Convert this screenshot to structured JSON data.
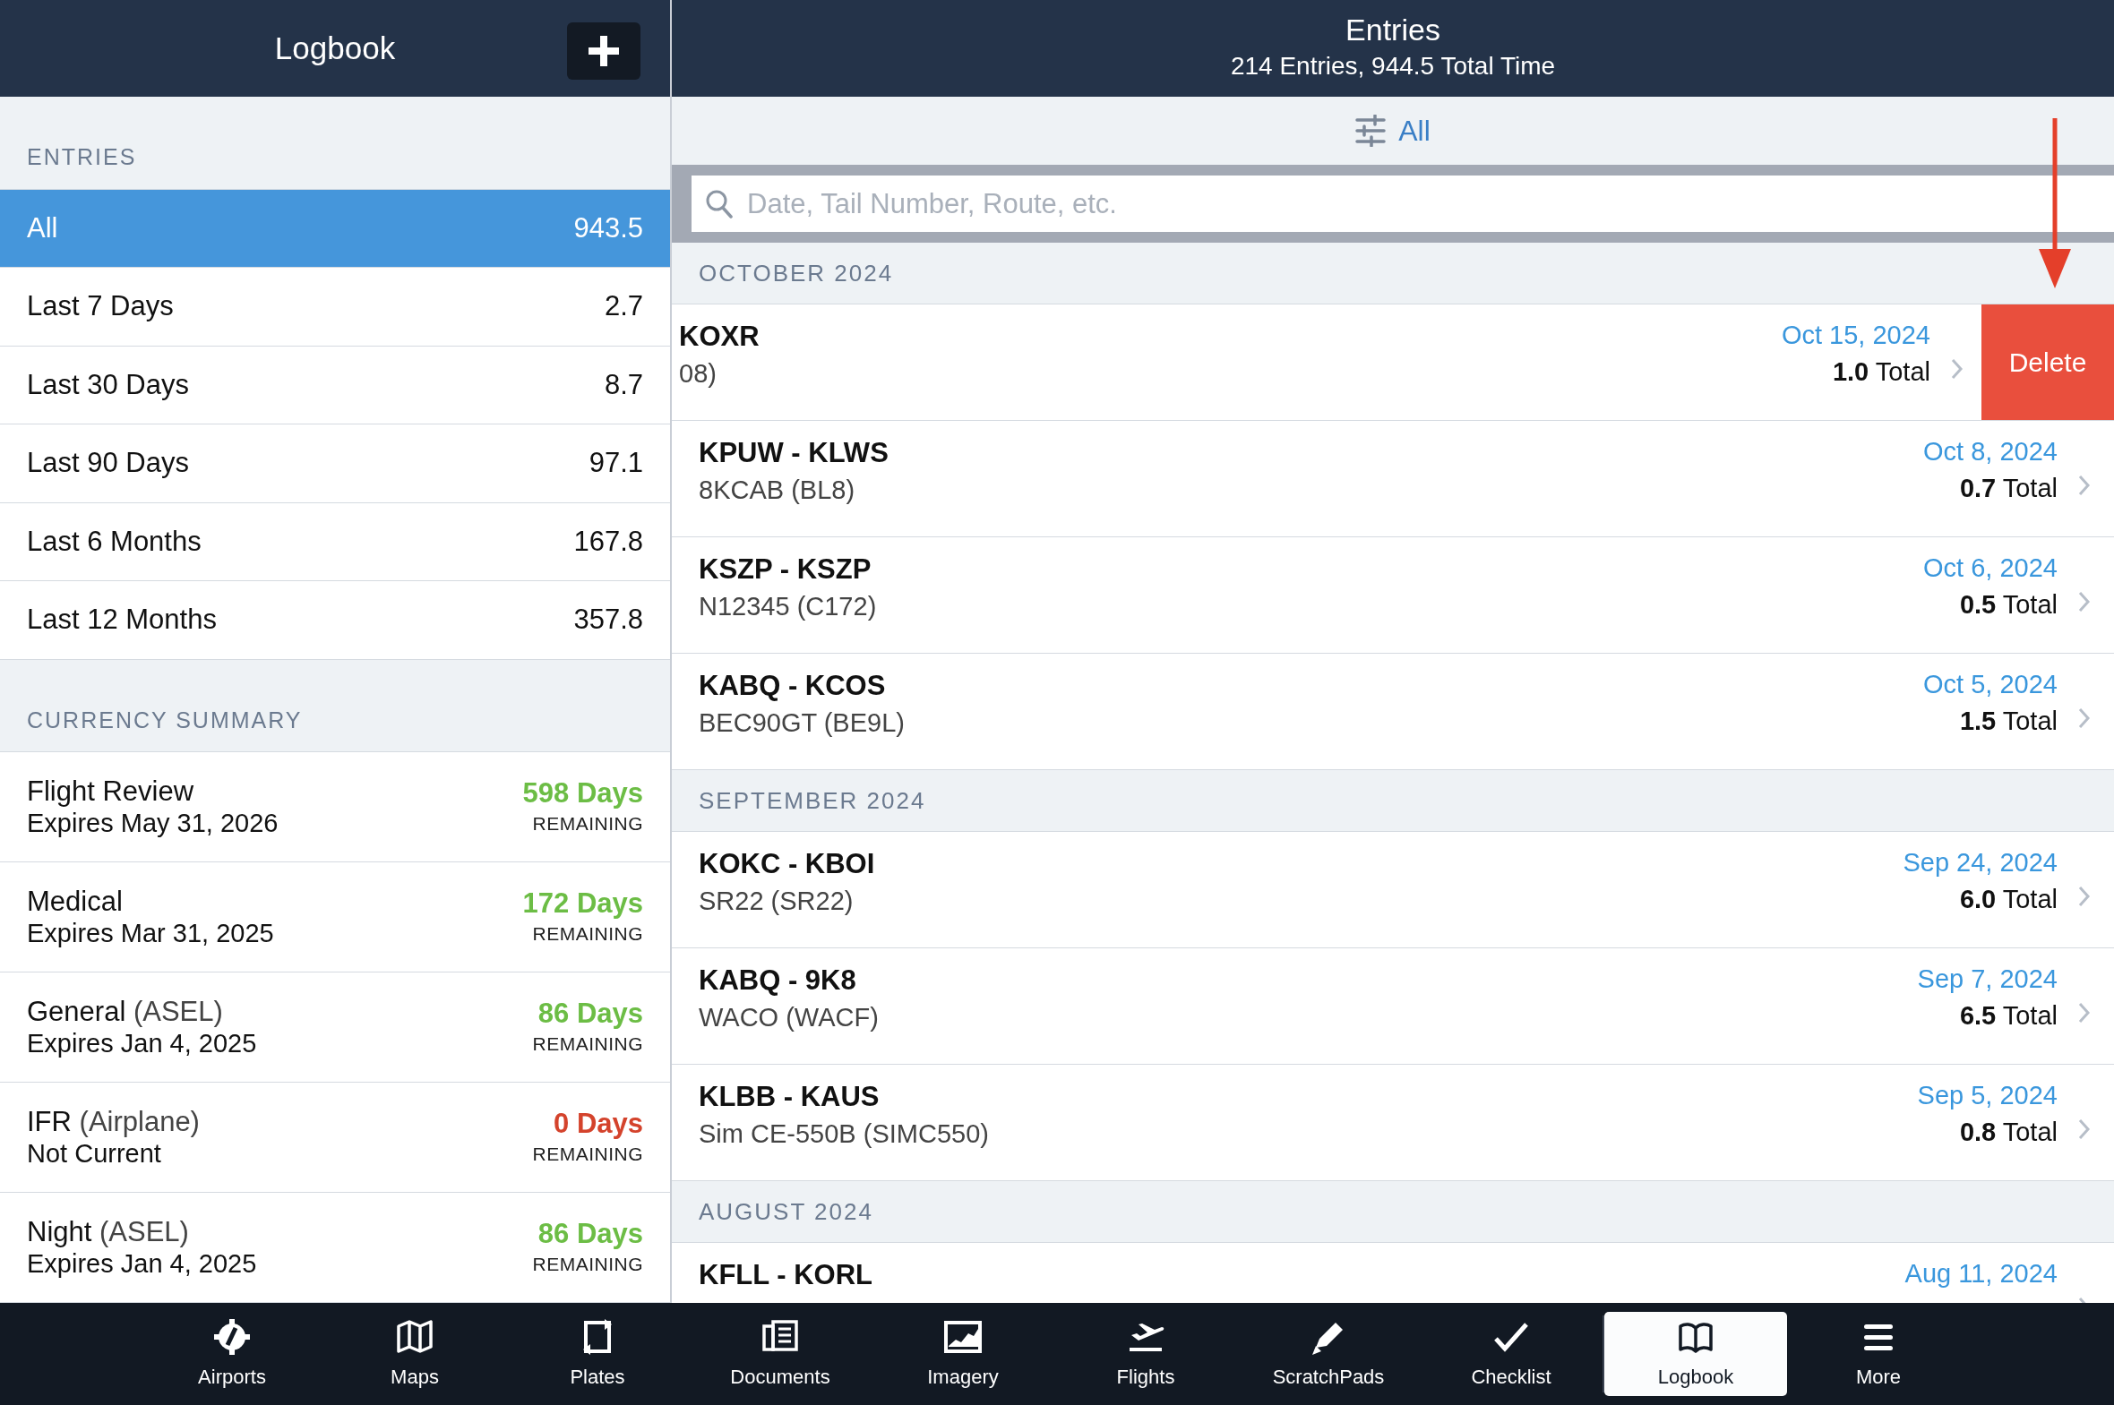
{
  "sidebar": {
    "title": "Logbook",
    "entries_heading": "ENTRIES",
    "entries": [
      {
        "label": "All",
        "value": "943.5",
        "selected": true
      },
      {
        "label": "Last 7 Days",
        "value": "2.7",
        "selected": false
      },
      {
        "label": "Last 30 Days",
        "value": "8.7",
        "selected": false
      },
      {
        "label": "Last 90 Days",
        "value": "97.1",
        "selected": false
      },
      {
        "label": "Last 6 Months",
        "value": "167.8",
        "selected": false
      },
      {
        "label": "Last 12 Months",
        "value": "357.8",
        "selected": false
      }
    ],
    "currency_heading": "CURRENCY SUMMARY",
    "currency": [
      {
        "name": "Flight Review",
        "detail": "Expires May 31, 2026",
        "days": "598 Days",
        "remaining": "REMAINING",
        "color": "#6cbd45"
      },
      {
        "name": "Medical",
        "detail": "Expires Mar 31, 2025",
        "days": "172 Days",
        "remaining": "REMAINING",
        "color": "#6cbd45"
      },
      {
        "name": "General",
        "qualifier": "(ASEL)",
        "detail": "Expires Jan 4, 2025",
        "days": "86 Days",
        "remaining": "REMAINING",
        "color": "#6cbd45"
      },
      {
        "name": "IFR",
        "qualifier": "(Airplane)",
        "detail": "Not Current",
        "days": "0 Days",
        "remaining": "REMAINING",
        "color": "#d4432c"
      },
      {
        "name": "Night",
        "qualifier": "(ASEL)",
        "detail": "Expires Jan 4, 2025",
        "days": "86 Days",
        "remaining": "REMAINING",
        "color": "#6cbd45"
      }
    ]
  },
  "main": {
    "title": "Entries",
    "subtitle": "214 Entries, 944.5 Total Time",
    "filter": "All",
    "search": {
      "placeholder": "Date, Tail Number, Route, etc."
    },
    "groups": [
      {
        "month": "OCTOBER 2024",
        "entries": [
          {
            "route": "KOXR",
            "aircraft": "08)",
            "date": "Oct 15, 2024",
            "total": "1.0",
            "total_label": "Total",
            "swiped": true,
            "delete_label": "Delete"
          },
          {
            "route": "KPUW - KLWS",
            "aircraft": "8KCAB (BL8)",
            "date": "Oct 8, 2024",
            "total": "0.7",
            "total_label": "Total",
            "swiped": false
          },
          {
            "route": "KSZP - KSZP",
            "aircraft": "N12345 (C172)",
            "date": "Oct 6, 2024",
            "total": "0.5",
            "total_label": "Total",
            "swiped": false
          },
          {
            "route": "KABQ - KCOS",
            "aircraft": "BEC90GT (BE9L)",
            "date": "Oct 5, 2024",
            "total": "1.5",
            "total_label": "Total",
            "swiped": false
          }
        ]
      },
      {
        "month": "SEPTEMBER 2024",
        "entries": [
          {
            "route": "KOKC - KBOI",
            "aircraft": "SR22 (SR22)",
            "date": "Sep 24, 2024",
            "total": "6.0",
            "total_label": "Total",
            "swiped": false
          },
          {
            "route": "KABQ - 9K8",
            "aircraft": "WACO (WACF)",
            "date": "Sep 7, 2024",
            "total": "6.5",
            "total_label": "Total",
            "swiped": false
          },
          {
            "route": "KLBB - KAUS",
            "aircraft": "Sim CE-550B (SIMC550)",
            "date": "Sep 5, 2024",
            "total": "0.8",
            "total_label": "Total",
            "swiped": false
          }
        ]
      },
      {
        "month": "AUGUST 2024",
        "entries": [
          {
            "route": "KFLL - KORL",
            "date": "Aug 11, 2024",
            "swiped": false
          }
        ]
      }
    ]
  },
  "tabs": [
    {
      "label": "Airports",
      "selected": false
    },
    {
      "label": "Maps",
      "selected": false
    },
    {
      "label": "Plates",
      "selected": false
    },
    {
      "label": "Documents",
      "selected": false
    },
    {
      "label": "Imagery",
      "selected": false
    },
    {
      "label": "Flights",
      "selected": false
    },
    {
      "label": "ScratchPads",
      "selected": false
    },
    {
      "label": "Checklist",
      "selected": false
    },
    {
      "label": "Logbook",
      "selected": true
    },
    {
      "label": "More",
      "selected": false
    }
  ]
}
